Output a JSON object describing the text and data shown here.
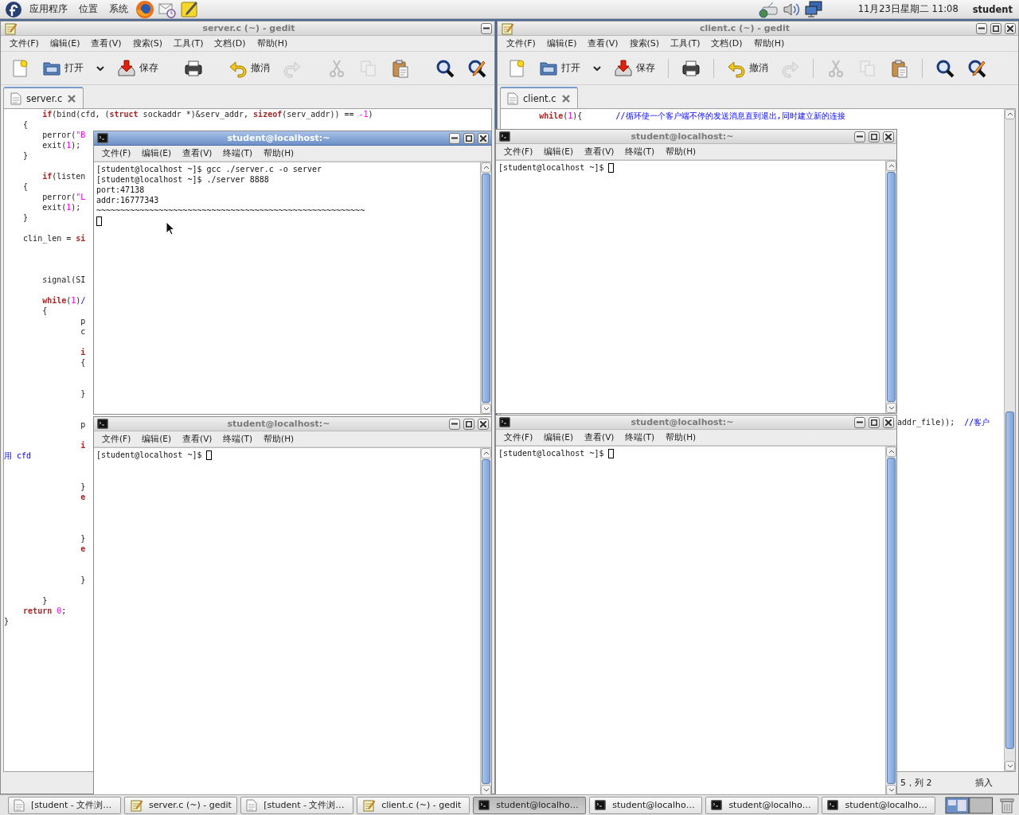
{
  "top_panel": {
    "menus": [
      "应用程序",
      "位置",
      "系统"
    ],
    "clock": "11月23日星期二 11:08",
    "user": "student"
  },
  "windows": [
    {
      "kind": "gedit",
      "title": "server.c (~) - gedit",
      "active": false,
      "buttons": [
        {
          "kind": "minimize"
        }
      ],
      "menu": [
        "文件(F)",
        "编辑(E)",
        "查看(V)",
        "搜索(S)",
        "工具(T)",
        "文档(D)",
        "帮助(H)"
      ],
      "toolbar": [
        {
          "kind": "new",
          "disabled": false
        },
        {
          "kind": "open",
          "label": "打开",
          "disabled": false
        },
        {
          "kind": "dropdown",
          "disabled": false
        },
        {
          "kind": "save",
          "label": "保存",
          "disabled": false
        },
        {
          "kind": "separator"
        },
        {
          "kind": "print",
          "disabled": false
        },
        {
          "kind": "separator"
        },
        {
          "kind": "undo",
          "label": "撤消",
          "disabled": false
        },
        {
          "kind": "redo",
          "disabled": true
        },
        {
          "kind": "separator"
        },
        {
          "kind": "cut",
          "disabled": true
        },
        {
          "kind": "copy",
          "disabled": true
        },
        {
          "kind": "paste",
          "disabled": false
        },
        {
          "kind": "separator"
        },
        {
          "kind": "find",
          "disabled": false
        },
        {
          "kind": "replace",
          "disabled": false
        }
      ],
      "tab": {
        "label": "server.c",
        "selected": true
      },
      "code": [
        {
          "kind": "code",
          "parts": [
            {
              "kind": "keyword",
              "text": "        if"
            },
            {
              "kind": "plain",
              "text": "(bind(cfd, ("
            },
            {
              "kind": "keyword",
              "text": "struct"
            },
            {
              "kind": "plain",
              "text": " sockaddr *)&serv_addr, "
            },
            {
              "kind": "keyword",
              "text": "sizeof"
            },
            {
              "kind": "plain",
              "text": "(serv_addr)) == "
            },
            {
              "kind": "number",
              "text": "-1"
            },
            {
              "kind": "plain",
              "text": ")"
            }
          ]
        },
        {
          "kind": "code",
          "parts": [
            {
              "kind": "plain",
              "text": "    {"
            }
          ]
        },
        {
          "kind": "code",
          "parts": [
            {
              "kind": "plain",
              "text": "        perror("
            },
            {
              "kind": "string",
              "text": "\"B"
            }
          ]
        },
        {
          "kind": "code",
          "parts": [
            {
              "kind": "plain",
              "text": "        exit("
            },
            {
              "kind": "number",
              "text": "1"
            },
            {
              "kind": "plain",
              "text": ");"
            }
          ]
        },
        {
          "kind": "code",
          "parts": [
            {
              "kind": "plain",
              "text": "    }"
            }
          ]
        },
        {
          "kind": "blank"
        },
        {
          "kind": "code",
          "parts": [
            {
              "kind": "keyword",
              "text": "        if"
            },
            {
              "kind": "plain",
              "text": "(listen"
            }
          ]
        },
        {
          "kind": "code",
          "parts": [
            {
              "kind": "plain",
              "text": "    {"
            }
          ]
        },
        {
          "kind": "code",
          "parts": [
            {
              "kind": "plain",
              "text": "        perror("
            },
            {
              "kind": "string",
              "text": "\"L"
            }
          ]
        },
        {
          "kind": "code",
          "parts": [
            {
              "kind": "plain",
              "text": "        exit("
            },
            {
              "kind": "number",
              "text": "1"
            },
            {
              "kind": "plain",
              "text": ");"
            }
          ]
        },
        {
          "kind": "code",
          "parts": [
            {
              "kind": "plain",
              "text": "    }"
            }
          ]
        },
        {
          "kind": "blank"
        },
        {
          "kind": "code",
          "parts": [
            {
              "kind": "plain",
              "text": "    clin_len = "
            },
            {
              "kind": "keyword",
              "text": "si"
            }
          ]
        },
        {
          "kind": "blank"
        },
        {
          "kind": "blank"
        },
        {
          "kind": "blank"
        },
        {
          "kind": "code",
          "parts": [
            {
              "kind": "plain",
              "text": "        signal(SI"
            }
          ]
        },
        {
          "kind": "blank"
        },
        {
          "kind": "code",
          "parts": [
            {
              "kind": "keyword",
              "text": "        while"
            },
            {
              "kind": "plain",
              "text": "("
            },
            {
              "kind": "number",
              "text": "1"
            },
            {
              "kind": "plain",
              "text": ")"
            },
            {
              "kind": "comment",
              "text": "/"
            }
          ]
        },
        {
          "kind": "code",
          "parts": [
            {
              "kind": "plain",
              "text": "        {"
            }
          ]
        },
        {
          "kind": "code",
          "parts": [
            {
              "kind": "plain",
              "text": "                p"
            }
          ]
        },
        {
          "kind": "code",
          "parts": [
            {
              "kind": "plain",
              "text": "                c"
            }
          ]
        },
        {
          "kind": "blank"
        },
        {
          "kind": "code",
          "parts": [
            {
              "kind": "keyword",
              "text": "                i"
            }
          ]
        },
        {
          "kind": "code",
          "parts": [
            {
              "kind": "plain",
              "text": "                {"
            }
          ]
        },
        {
          "kind": "blank"
        },
        {
          "kind": "blank"
        },
        {
          "kind": "code",
          "parts": [
            {
              "kind": "plain",
              "text": "                }"
            }
          ]
        },
        {
          "kind": "blank"
        },
        {
          "kind": "blank"
        },
        {
          "kind": "code",
          "parts": [
            {
              "kind": "plain",
              "text": "                p"
            }
          ]
        },
        {
          "kind": "blank"
        },
        {
          "kind": "code",
          "parts": [
            {
              "kind": "keyword",
              "text": "                i"
            }
          ]
        },
        {
          "kind": "code",
          "parts": [
            {
              "kind": "comment",
              "text": "用 cfd"
            }
          ]
        },
        {
          "kind": "blank"
        },
        {
          "kind": "blank"
        },
        {
          "kind": "code",
          "parts": [
            {
              "kind": "plain",
              "text": "                }"
            }
          ]
        },
        {
          "kind": "code",
          "parts": [
            {
              "kind": "keyword",
              "text": "                e"
            }
          ]
        },
        {
          "kind": "blank"
        },
        {
          "kind": "blank"
        },
        {
          "kind": "blank"
        },
        {
          "kind": "code",
          "parts": [
            {
              "kind": "plain",
              "text": "                }"
            }
          ]
        },
        {
          "kind": "code",
          "parts": [
            {
              "kind": "keyword",
              "text": "                e"
            }
          ]
        },
        {
          "kind": "blank"
        },
        {
          "kind": "blank"
        },
        {
          "kind": "code",
          "parts": [
            {
              "kind": "plain",
              "text": "                }"
            }
          ]
        },
        {
          "kind": "blank"
        },
        {
          "kind": "code",
          "parts": [
            {
              "kind": "plain",
              "text": "        }"
            }
          ]
        },
        {
          "kind": "code",
          "parts": [
            {
              "kind": "keyword",
              "text": "    return "
            },
            {
              "kind": "number",
              "text": "0"
            },
            {
              "kind": "plain",
              "text": ";"
            }
          ]
        },
        {
          "kind": "code",
          "parts": [
            {
              "kind": "plain",
              "text": "}"
            }
          ]
        }
      ]
    },
    {
      "kind": "gedit",
      "title": "client.c (~) - gedit",
      "active": false,
      "buttons": [
        {
          "kind": "minimize"
        },
        {
          "kind": "maximize"
        },
        {
          "kind": "close"
        }
      ],
      "menu": [
        "文件(F)",
        "编辑(E)",
        "查看(V)",
        "搜索(S)",
        "工具(T)",
        "文档(D)",
        "帮助(H)"
      ],
      "toolbar": [
        {
          "kind": "new",
          "disabled": false
        },
        {
          "kind": "open",
          "label": "打开",
          "disabled": false
        },
        {
          "kind": "dropdown",
          "disabled": false
        },
        {
          "kind": "save",
          "label": "保存",
          "disabled": false
        },
        {
          "kind": "separator"
        },
        {
          "kind": "print",
          "disabled": false
        },
        {
          "kind": "separator"
        },
        {
          "kind": "undo",
          "label": "撤消",
          "disabled": false
        },
        {
          "kind": "redo",
          "disabled": true
        },
        {
          "kind": "separator"
        },
        {
          "kind": "cut",
          "disabled": true
        },
        {
          "kind": "copy",
          "disabled": true
        },
        {
          "kind": "paste",
          "disabled": false
        },
        {
          "kind": "separator"
        },
        {
          "kind": "find",
          "disabled": false
        },
        {
          "kind": "replace",
          "disabled": false
        }
      ],
      "tab": {
        "label": "client.c",
        "selected": true
      },
      "code": [
        {
          "kind": "code",
          "parts": [
            {
              "kind": "keyword",
              "text": "        while"
            },
            {
              "kind": "plain",
              "text": "("
            },
            {
              "kind": "number",
              "text": "1"
            },
            {
              "kind": "plain",
              "text": "){       "
            },
            {
              "kind": "comment",
              "text": "//循环使一个客户端不停的发送消息直到退出,同时建立新的连接"
            }
          ]
        },
        {
          "kind": "tail",
          "parts": [
            {
              "kind": "plain",
              "text": "addr_file));  "
            },
            {
              "kind": "comment",
              "text": "//客户"
            }
          ]
        }
      ],
      "status": [
        "5，列 2",
        "插入"
      ]
    },
    {
      "kind": "terminal",
      "title": "student@localhost:~",
      "active": true,
      "buttons": [
        {
          "kind": "minimize"
        },
        {
          "kind": "maximize"
        },
        {
          "kind": "close"
        }
      ],
      "menu": [
        "文件(F)",
        "编辑(E)",
        "查看(V)",
        "终端(T)",
        "帮助(H)"
      ],
      "lines": [
        {
          "kind": "output",
          "text": "[student@localhost ~]$ gcc ./server.c -o server"
        },
        {
          "kind": "output",
          "text": "[student@localhost ~]$ ./server 8888"
        },
        {
          "kind": "output",
          "text": "port:47138"
        },
        {
          "kind": "output",
          "text": "addr:16777343"
        },
        {
          "kind": "output",
          "text": "~~~~~~~~~~~~~~~~~~~~~~~~~~~~~~~~~~~~~~~~~~~~~~~~~~~~~~~~"
        },
        {
          "kind": "cursor"
        }
      ]
    },
    {
      "kind": "terminal",
      "title": "student@localhost:~",
      "active": false,
      "buttons": [
        {
          "kind": "minimize"
        },
        {
          "kind": "maximize"
        },
        {
          "kind": "close"
        }
      ],
      "menu": [
        "文件(F)",
        "编辑(E)",
        "查看(V)",
        "终端(T)",
        "帮助(H)"
      ],
      "lines": [
        {
          "kind": "prompt",
          "text": "[student@localhost ~]$"
        }
      ]
    },
    {
      "kind": "terminal",
      "title": "student@localhost:~",
      "active": false,
      "buttons": [
        {
          "kind": "minimize"
        },
        {
          "kind": "maximize"
        },
        {
          "kind": "close"
        }
      ],
      "menu": [
        "文件(F)",
        "编辑(E)",
        "查看(V)",
        "终端(T)",
        "帮助(H)"
      ],
      "lines": [
        {
          "kind": "prompt",
          "text": "[student@localhost ~]$"
        }
      ]
    },
    {
      "kind": "terminal",
      "title": "student@localhost:~",
      "active": false,
      "buttons": [
        {
          "kind": "minimize"
        },
        {
          "kind": "maximize"
        },
        {
          "kind": "close"
        }
      ],
      "menu": [
        "文件(F)",
        "编辑(E)",
        "查看(V)",
        "终端(T)",
        "帮助(H)"
      ],
      "lines": [
        {
          "kind": "prompt",
          "text": "[student@localhost ~]$"
        }
      ]
    }
  ],
  "taskbar": [
    {
      "kind": "folder",
      "label": "[student - 文件浏…",
      "selected": false
    },
    {
      "kind": "gedit",
      "label": "server.c (~) - gedit",
      "selected": false
    },
    {
      "kind": "folder",
      "label": "[student - 文件浏…",
      "selected": false
    },
    {
      "kind": "gedit",
      "label": "client.c (~) - gedit",
      "selected": false
    },
    {
      "kind": "terminal",
      "label": "student@localho…",
      "selected": true
    },
    {
      "kind": "terminal",
      "label": "student@localho…",
      "selected": false
    },
    {
      "kind": "terminal",
      "label": "student@localho…",
      "selected": false
    },
    {
      "kind": "terminal",
      "label": "student@localho…",
      "selected": false
    }
  ]
}
